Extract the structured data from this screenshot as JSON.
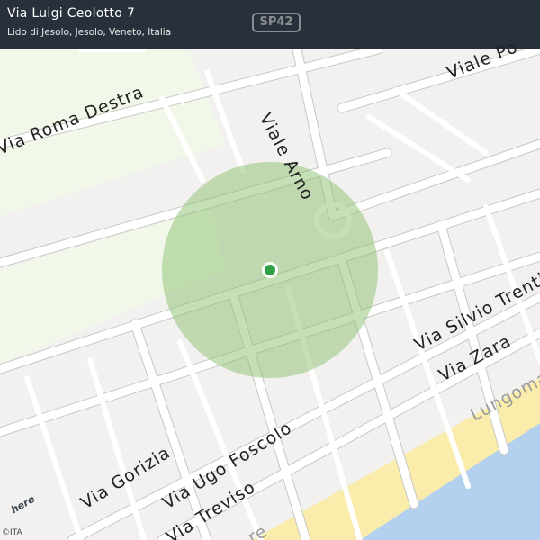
{
  "header": {
    "title": "Via Luigi Ceolotto 7",
    "subtitle": "Lido di Jesolo, Jesolo, Veneto, Italia"
  },
  "shield": "SP42",
  "streets": {
    "via_roma_destra": "Via  Roma  Destra",
    "viale_arno": "Viale  Arno",
    "viale_po": "Viale  Po",
    "via_silvio_trentin": "Via  Silvio  Trentin",
    "via_zara": "Via  Zara",
    "via_gorizia": "Via  Gorizia",
    "via_ugo_foscolo": "Via  Ugo  Foscolo",
    "via_treviso": "Via  Treviso",
    "lungomare": "Lungomare",
    "partial_bottom": "re"
  },
  "footer": {
    "logo": "here",
    "copyright": "©ITA"
  },
  "colors": {
    "header_bg": "#1c2630",
    "land": "#f2f1ef",
    "road": "#ffffff",
    "road_outline": "#c9c7c3",
    "park": "#f1f8e9",
    "beach": "#faecaa",
    "water": "#b3d1ee",
    "accuracy_circle": "#8bc070",
    "location_dot": "#2ea043"
  },
  "icons": {
    "location": "location-dot-icon",
    "logo": "here-logo-icon"
  }
}
